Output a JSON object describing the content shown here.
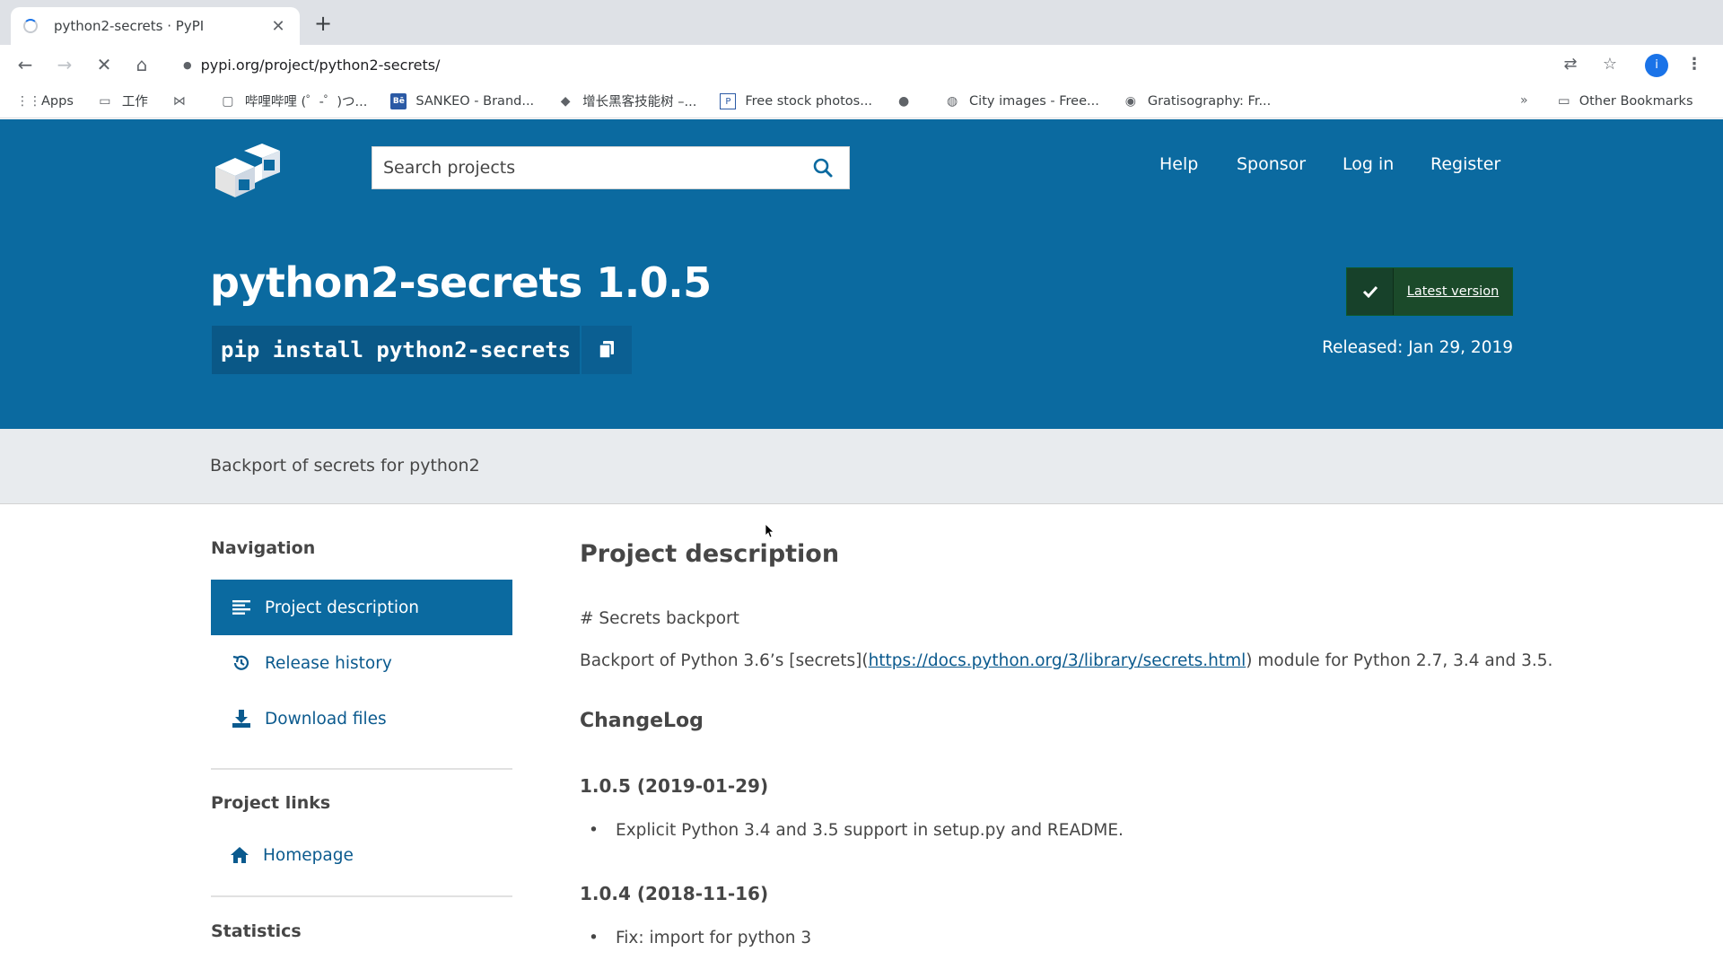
{
  "browser": {
    "tab_title": "python2-secrets · PyPI",
    "tab_close": "✕",
    "new_tab": "+",
    "url": "pypi.org/project/python2-secrets/",
    "bookmarks": [
      {
        "icon": "apps-grid-icon",
        "label": "Apps"
      },
      {
        "icon": "folder-icon",
        "label": "工作"
      },
      {
        "icon": "bookmark-icon",
        "label": ""
      },
      {
        "icon": "bilibili-icon",
        "label": "哔哩哔哩 (゜-゜)つ..."
      },
      {
        "icon": "behance-icon",
        "label": "SANKEO - Brand..."
      },
      {
        "icon": "site-icon",
        "label": "增长黑客技能树 –..."
      },
      {
        "icon": "site-icon",
        "label": "Free stock photos..."
      },
      {
        "icon": "globe-icon",
        "label": ""
      },
      {
        "icon": "globe-icon",
        "label": "City images - Free..."
      },
      {
        "icon": "site-icon",
        "label": "Gratisography: Fr..."
      }
    ],
    "bookmarks_more": "»",
    "other_bookmarks": "Other Bookmarks",
    "avatar_letter": "i"
  },
  "header": {
    "search_placeholder": "Search projects",
    "nav": [
      "Help",
      "Sponsor",
      "Log in",
      "Register"
    ]
  },
  "package": {
    "title": "python2-secrets 1.0.5",
    "pip_command": "pip install python2-secrets",
    "latest_version_label": "Latest version",
    "released": "Released: Jan 29, 2019",
    "summary": "Backport of secrets for python2"
  },
  "sidebar": {
    "navigation_heading": "Navigation",
    "nav_items": [
      "Project description",
      "Release history",
      "Download files"
    ],
    "project_links_heading": "Project links",
    "homepage": "Homepage",
    "statistics_heading": "Statistics"
  },
  "main": {
    "heading": "Project description",
    "readme_title": "# Secrets backport",
    "desc_before": "Backport of Python 3.6’s [secrets](",
    "desc_link": "https://docs.python.org/3/library/secrets.html",
    "desc_after": ") module for Python 2.7, 3.4 and 3.5.",
    "changelog_heading": "ChangeLog",
    "releases": [
      {
        "version": "1.0.5 (2019-01-29)",
        "notes": [
          "Explicit Python 3.4 and 3.5 support in setup.py and README."
        ]
      },
      {
        "version": "1.0.4 (2018-11-16)",
        "notes": [
          "Fix: import for python 3"
        ]
      }
    ]
  },
  "colors": {
    "pypi_blue": "#0b6aa0",
    "summary_band": "#e8ebee",
    "latest_green": "#1b4a2a",
    "link_blue": "#0b5a8e"
  }
}
